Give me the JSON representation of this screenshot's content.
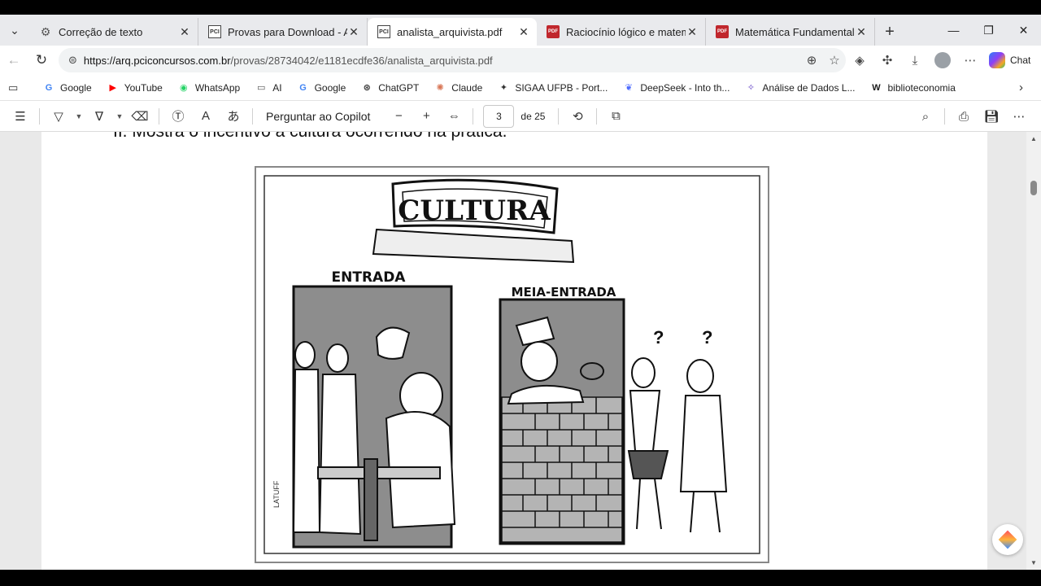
{
  "tabs": [
    {
      "title": "Correção de texto",
      "icon": "gear-icon",
      "active": false
    },
    {
      "title": "Provas para Download - Analist",
      "icon": "pci-icon",
      "active": false
    },
    {
      "title": "analista_arquivista.pdf",
      "icon": "pci-icon",
      "active": true
    },
    {
      "title": "Raciocínio lógico e matemática",
      "icon": "pdf-icon",
      "active": false
    },
    {
      "title": "Matemática Fundamental -- Bo",
      "icon": "pdf-icon",
      "active": false
    }
  ],
  "address": {
    "host": "https://arq.pciconcursos.com.br",
    "path": "/provas/28734042/e1181ecdfe36/analista_arquivista.pdf"
  },
  "chat_label": "Chat",
  "bookmarks": [
    {
      "label": "Google",
      "icon": "google-icon",
      "color": "#4285f4"
    },
    {
      "label": "YouTube",
      "icon": "youtube-icon",
      "color": "#ff0000"
    },
    {
      "label": "WhatsApp",
      "icon": "whatsapp-icon",
      "color": "#25d366"
    },
    {
      "label": "AI",
      "icon": "folder-icon",
      "color": "#555555"
    },
    {
      "label": "Google",
      "icon": "google-icon",
      "color": "#4285f4"
    },
    {
      "label": "ChatGPT",
      "icon": "chatgpt-icon",
      "color": "#333333"
    },
    {
      "label": "Claude",
      "icon": "claude-icon",
      "color": "#d97757"
    },
    {
      "label": "SIGAA UFPB - Port...",
      "icon": "sigaa-icon",
      "color": "#333333"
    },
    {
      "label": "DeepSeek - Into th...",
      "icon": "deepseek-icon",
      "color": "#4d6bfe"
    },
    {
      "label": "Análise de Dados L...",
      "icon": "analise-icon",
      "color": "#5f3dc4"
    },
    {
      "label": "biblioteconomia",
      "icon": "w-icon",
      "color": "#1a1a1a"
    }
  ],
  "pdf_toolbar": {
    "copilot_label": "Perguntar ao Copilot",
    "page_current": "3",
    "page_of": "de 25"
  },
  "document": {
    "line_text": "II.   Mostra o incentivo à cultura ocorrendo na prática.",
    "cartoon": {
      "sign": "CULTURA",
      "door_left": "ENTRADA",
      "door_right": "MEIA-ENTRADA"
    }
  }
}
